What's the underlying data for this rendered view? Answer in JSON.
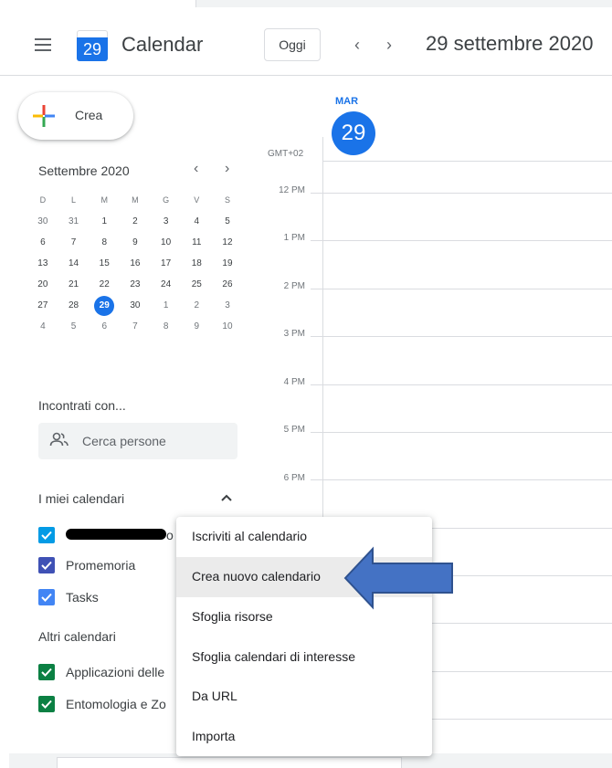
{
  "header": {
    "logo_day": "29",
    "app_title": "Calendar",
    "today_label": "Oggi",
    "prev_icon": "chevron-left-icon",
    "next_icon": "chevron-right-icon",
    "date_title": "29 settembre 2020"
  },
  "sidebar": {
    "create_label": "Crea",
    "mini_calendar": {
      "title": "Settembre 2020",
      "weekdays": [
        "D",
        "L",
        "M",
        "M",
        "G",
        "V",
        "S"
      ],
      "weeks": [
        [
          "30",
          "31",
          "1",
          "2",
          "3",
          "4",
          "5"
        ],
        [
          "6",
          "7",
          "8",
          "9",
          "10",
          "11",
          "12"
        ],
        [
          "13",
          "14",
          "15",
          "16",
          "17",
          "18",
          "19"
        ],
        [
          "20",
          "21",
          "22",
          "23",
          "24",
          "25",
          "26"
        ],
        [
          "27",
          "28",
          "29",
          "30",
          "1",
          "2",
          "3"
        ],
        [
          "4",
          "5",
          "6",
          "7",
          "8",
          "9",
          "10"
        ]
      ],
      "selected": "29"
    },
    "meet_title": "Incontrati con...",
    "search_placeholder": "Cerca persone",
    "my_calendars_title": "I miei calendari",
    "my_calendars": [
      {
        "label": "o",
        "color": "#039be5"
      },
      {
        "label": "Promemoria",
        "color": "#3f51b5"
      },
      {
        "label": "Tasks",
        "color": "#4285f4"
      }
    ],
    "other_calendars_title": "Altri calendari",
    "other_calendars": [
      {
        "label": "Applicazioni delle",
        "color": "#0b8043"
      },
      {
        "label": "Entomologia e Zo",
        "color": "#0b8043"
      }
    ]
  },
  "day_view": {
    "dow": "MAR",
    "day": "29",
    "timezone": "GMT+02",
    "times": [
      "12 PM",
      "1 PM",
      "2 PM",
      "3 PM",
      "4 PM",
      "5 PM",
      "6 PM"
    ]
  },
  "menu": {
    "items": [
      "Iscriviti al calendario",
      "Crea nuovo calendario",
      "Sfoglia risorse",
      "Sfoglia calendari di interesse",
      "Da URL",
      "Importa"
    ],
    "highlighted_index": 1
  },
  "colors": {
    "accent": "#1a73e8",
    "annotation_arrow": "#4472c4"
  }
}
